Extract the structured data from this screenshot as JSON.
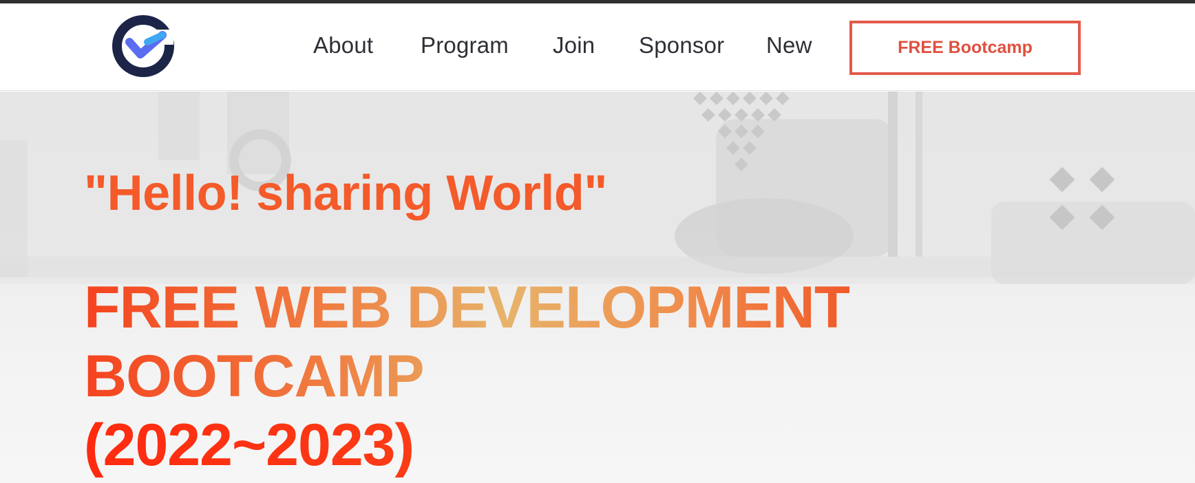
{
  "nav": {
    "items": [
      "About",
      "Program",
      "Join",
      "Sponsor",
      "New"
    ],
    "cta_label": "FREE Bootcamp"
  },
  "hero": {
    "tagline": "\"Hello! sharing World\"",
    "headline_lines": [
      "FREE WEB DEVELOPMENT",
      "BOOTCAMP",
      "(2022~2023)"
    ]
  },
  "colors": {
    "accent": "#f45a2a",
    "cta_border": "#e25a4a",
    "nav_text": "#2d2f36",
    "logo_navy": "#1c2548",
    "logo_blue": "#5a6cf0"
  }
}
